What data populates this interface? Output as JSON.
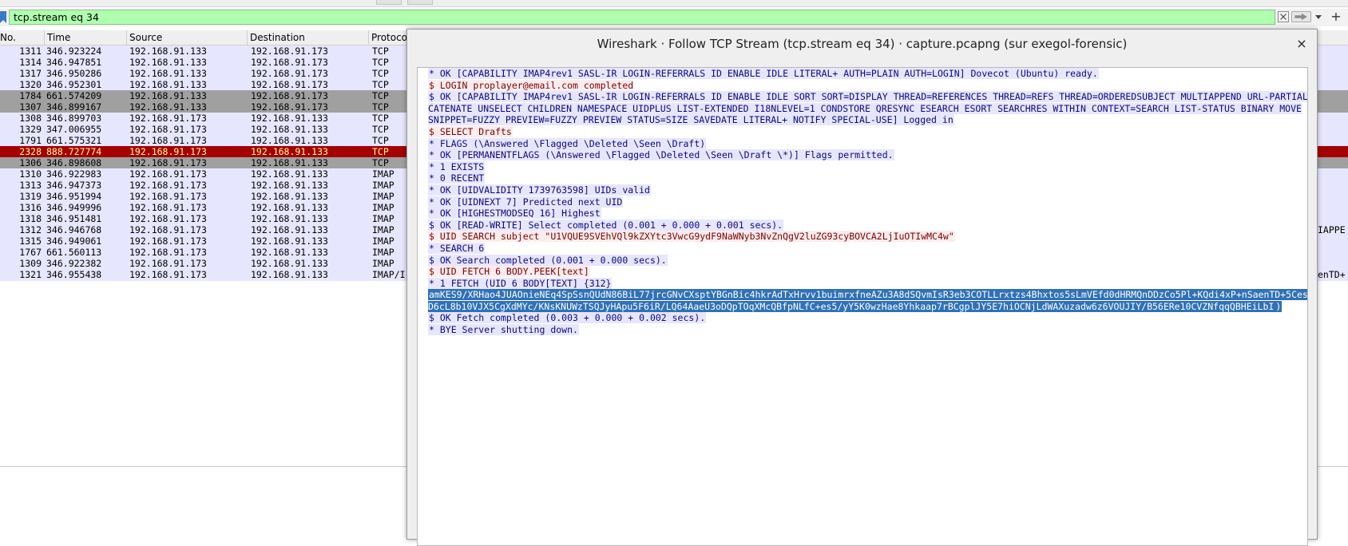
{
  "filter": {
    "value": "tcp.stream eq 34"
  },
  "columns": [
    "No.",
    "Time",
    "Source",
    "Destination",
    "Protoco"
  ],
  "packets": [
    {
      "no": "1311",
      "time": "346.923224",
      "src": "192.168.91.133",
      "dst": "192.168.91.173",
      "proto": "TCP",
      "info": "",
      "style": "tcp"
    },
    {
      "no": "1314",
      "time": "346.947851",
      "src": "192.168.91.133",
      "dst": "192.168.91.173",
      "proto": "TCP",
      "info": "",
      "style": "tcp"
    },
    {
      "no": "1317",
      "time": "346.950286",
      "src": "192.168.91.133",
      "dst": "192.168.91.173",
      "proto": "TCP",
      "info": "",
      "style": "tcp"
    },
    {
      "no": "1320",
      "time": "346.952301",
      "src": "192.168.91.133",
      "dst": "192.168.91.173",
      "proto": "TCP",
      "info": "",
      "style": "tcp"
    },
    {
      "no": "1784",
      "time": "661.574209",
      "src": "192.168.91.133",
      "dst": "192.168.91.173",
      "proto": "TCP",
      "info": "",
      "style": "gray"
    },
    {
      "no": "1307",
      "time": "346.899167",
      "src": "192.168.91.133",
      "dst": "192.168.91.173",
      "proto": "TCP",
      "info": "",
      "style": "gray"
    },
    {
      "no": "1308",
      "time": "346.899703",
      "src": "192.168.91.173",
      "dst": "192.168.91.133",
      "proto": "TCP",
      "info": "",
      "style": "tcp"
    },
    {
      "no": "1329",
      "time": "347.006955",
      "src": "192.168.91.173",
      "dst": "192.168.91.133",
      "proto": "TCP",
      "info": "",
      "style": "tcp"
    },
    {
      "no": "1791",
      "time": "661.575321",
      "src": "192.168.91.173",
      "dst": "192.168.91.133",
      "proto": "TCP",
      "info": "",
      "style": "tcp"
    },
    {
      "no": "2328",
      "time": "888.727774",
      "src": "192.168.91.173",
      "dst": "192.168.91.133",
      "proto": "TCP",
      "info": "",
      "style": "red"
    },
    {
      "no": "1306",
      "time": "346.898608",
      "src": "192.168.91.173",
      "dst": "192.168.91.133",
      "proto": "TCP",
      "info": "",
      "style": "gray"
    },
    {
      "no": "1310",
      "time": "346.922983",
      "src": "192.168.91.173",
      "dst": "192.168.91.133",
      "proto": "IMAP",
      "info": "",
      "style": "imap"
    },
    {
      "no": "1313",
      "time": "346.947373",
      "src": "192.168.91.173",
      "dst": "192.168.91.133",
      "proto": "IMAP",
      "info": "",
      "style": "imap"
    },
    {
      "no": "1319",
      "time": "346.951994",
      "src": "192.168.91.173",
      "dst": "192.168.91.133",
      "proto": "IMAP",
      "info": "",
      "style": "imap"
    },
    {
      "no": "1316",
      "time": "346.949996",
      "src": "192.168.91.173",
      "dst": "192.168.91.133",
      "proto": "IMAP",
      "info": "",
      "style": "imap"
    },
    {
      "no": "1318",
      "time": "346.951481",
      "src": "192.168.91.173",
      "dst": "192.168.91.133",
      "proto": "IMAP",
      "info": "",
      "style": "imap"
    },
    {
      "no": "1312",
      "time": "346.946768",
      "src": "192.168.91.173",
      "dst": "192.168.91.133",
      "proto": "IMAP",
      "info": "IAPPE",
      "style": "imap"
    },
    {
      "no": "1315",
      "time": "346.949061",
      "src": "192.168.91.173",
      "dst": "192.168.91.133",
      "proto": "IMAP",
      "info": "",
      "style": "imap"
    },
    {
      "no": "1767",
      "time": "661.560113",
      "src": "192.168.91.173",
      "dst": "192.168.91.133",
      "proto": "IMAP",
      "info": "",
      "style": "imap"
    },
    {
      "no": "1309",
      "time": "346.922382",
      "src": "192.168.91.173",
      "dst": "192.168.91.133",
      "proto": "IMAP",
      "info": "",
      "style": "imap"
    },
    {
      "no": "1321",
      "time": "346.955438",
      "src": "192.168.91.173",
      "dst": "192.168.91.133",
      "proto": "IMAP/I",
      "info": "enTD+",
      "style": "imap"
    }
  ],
  "dialog": {
    "title": "Wireshark · Follow TCP Stream (tcp.stream eq 34) · capture.pcapng (sur exegol-forensic)",
    "close": "×"
  },
  "stream": [
    {
      "dir": "srv",
      "text": "* OK [CAPABILITY IMAP4rev1 SASL-IR LOGIN-REFERRALS ID ENABLE IDLE LITERAL+ AUTH=PLAIN AUTH=LOGIN] Dovecot (Ubuntu) ready."
    },
    {
      "dir": "cli",
      "text": "$ LOGIN proplayer@email.com completed"
    },
    {
      "dir": "srv",
      "text": "$ OK [CAPABILITY IMAP4rev1 SASL-IR LOGIN-REFERRALS ID ENABLE IDLE SORT SORT=DISPLAY THREAD=REFERENCES THREAD=REFS THREAD=ORDEREDSUBJECT MULTIAPPEND URL-PARTIAL CATENATE UNSELECT CHILDREN NAMESPACE UIDPLUS LIST-EXTENDED I18NLEVEL=1 CONDSTORE QRESYNC ESEARCH ESORT SEARCHRES WITHIN CONTEXT=SEARCH LIST-STATUS BINARY MOVE SNIPPET=FUZZY PREVIEW=FUZZY PREVIEW STATUS=SIZE SAVEDATE LITERAL+ NOTIFY SPECIAL-USE] Logged in"
    },
    {
      "dir": "cli",
      "text": "$ SELECT Drafts"
    },
    {
      "dir": "srv",
      "text": "* FLAGS (\\Answered \\Flagged \\Deleted \\Seen \\Draft)"
    },
    {
      "dir": "srv",
      "text": "* OK [PERMANENTFLAGS (\\Answered \\Flagged \\Deleted \\Seen \\Draft \\*)] Flags permitted."
    },
    {
      "dir": "srv",
      "text": "* 1 EXISTS"
    },
    {
      "dir": "srv",
      "text": "* 0 RECENT"
    },
    {
      "dir": "srv",
      "text": "* OK [UIDVALIDITY 1739763598] UIDs valid"
    },
    {
      "dir": "srv",
      "text": "* OK [UIDNEXT 7] Predicted next UID"
    },
    {
      "dir": "srv",
      "text": "* OK [HIGHESTMODSEQ 16] Highest"
    },
    {
      "dir": "srv",
      "text": "$ OK [READ-WRITE] Select completed (0.001 + 0.000 + 0.001 secs)."
    },
    {
      "dir": "cli",
      "text": "$ UID SEARCH subject \"U1VQUE9SVEhVQl9kZXYtc3VwcG9ydF9NaWNyb3NvZnQgV2luZG93cyBOVCA2LjIuOTIwMC4w\""
    },
    {
      "dir": "srv",
      "text": "* SEARCH 6"
    },
    {
      "dir": "srv",
      "text": "$ OK Search completed (0.001 + 0.000 secs)."
    },
    {
      "dir": "cli",
      "text": "$ UID FETCH 6 BODY.PEEK[text]"
    },
    {
      "dir": "srv",
      "text": "* 1 FETCH (UID 6 BODY[TEXT] {312}"
    },
    {
      "dir": "sel",
      "text": "amKES9/XRHao4JUAOnieNEq4SpSsnQUdN86BiL77jrcGNvCXsptYBGnBic4hkrAdTxHrvv1buimrxfneAZu3A8dSQvmIsR3eb3COTLLrxtzs4Bhxtos5sLmVEfd0dHRMQnDDzCo5Pl+KQdi4xP+nSaenTD+5CesD6cL8b10VJX5CgXdMYc/KNsKNUWzTSQJyHApu5F6iR/LQ64AaeU3oDQpTOqXMcQBfpNLfC+es5/yY5K0wzHae8Yhkaap7rBCgplJY5E7hiOCNjLdWAXuzadw6z6VOUJIY/B56ERe10CVZNfqqQBHEiLbI",
      "tail": ")"
    },
    {
      "dir": "srv",
      "text": "$ OK Fetch completed (0.003 + 0.000 + 0.002 secs)."
    },
    {
      "dir": "srv",
      "text": "* BYE Server shutting down."
    }
  ]
}
